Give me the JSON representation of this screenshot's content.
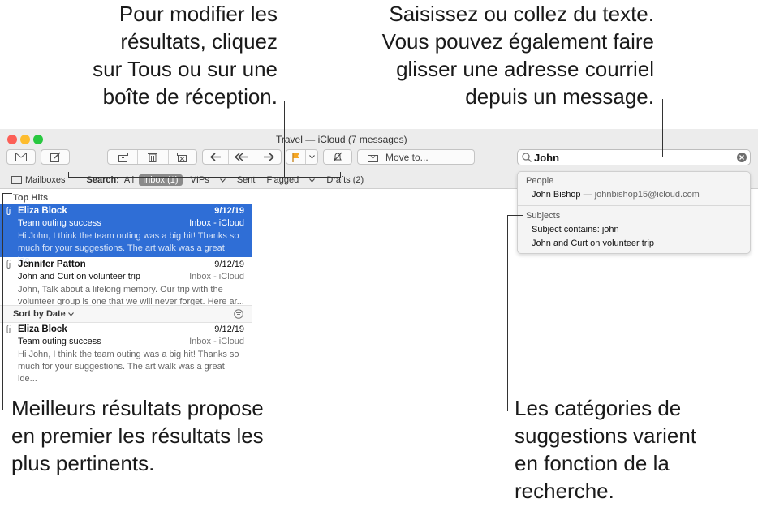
{
  "callouts": {
    "top_left": [
      "Pour modifier les",
      "résultats, cliquez",
      "sur Tous ou sur une",
      "boîte de réception."
    ],
    "top_right": [
      "Saisissez ou collez du texte.",
      "Vous pouvez également faire",
      "glisser une adresse courriel",
      "depuis un message."
    ],
    "bottom_left": [
      "Meilleurs résultats propose",
      "en premier les résultats les",
      "plus pertinents."
    ],
    "bottom_right": [
      "Les catégories de",
      "suggestions varient",
      "en fonction de la",
      "recherche."
    ]
  },
  "window": {
    "title": "Travel — iCloud (7 messages)",
    "toolbar": {
      "move_to_label": "Move to..."
    },
    "search": {
      "value": "John"
    },
    "scope_bar": {
      "mailboxes_label": "Mailboxes",
      "search_label": "Search:",
      "all": "All",
      "inbox": "Inbox (1)",
      "vips": "VIPs",
      "sent": "Sent",
      "flagged": "Flagged",
      "drafts": "Drafts (2)"
    },
    "list": {
      "top_hits_label": "Top Hits",
      "sort_label": "Sort by Date",
      "messages": [
        {
          "from": "Eliza Block",
          "date": "9/12/19",
          "subject": "Team outing success",
          "mailbox": "Inbox - iCloud",
          "preview1": "Hi John, I think the team outing was a big hit! Thanks so",
          "preview2": "much for your suggestions. The art walk was a great ide..."
        },
        {
          "from": "Jennifer Patton",
          "date": "9/12/19",
          "subject": "John and Curt on volunteer trip",
          "mailbox": "Inbox - iCloud",
          "preview1": "John, Talk about a lifelong memory. Our trip with the",
          "preview2": "volunteer group is one that we will never forget. Here ar..."
        },
        {
          "from": "Eliza Block",
          "date": "9/12/19",
          "subject": "Team outing success",
          "mailbox": "Inbox - iCloud",
          "preview1": "Hi John, I think the team outing was a big hit! Thanks so",
          "preview2": "much for your suggestions. The art walk was a great ide..."
        }
      ]
    },
    "suggestions": {
      "people_header": "People",
      "person_name": "John Bishop",
      "person_email": " — johnbishop15@icloud.com",
      "subjects_header": "Subjects",
      "subject_contains": "Subject contains: john",
      "subject_item": "John and Curt on volunteer trip"
    }
  },
  "colors": {
    "selection": "#2f6ed6",
    "close": "#fc5f57",
    "minimize": "#fdbc2e",
    "zoom": "#28c840",
    "flag": "#f5a623"
  }
}
